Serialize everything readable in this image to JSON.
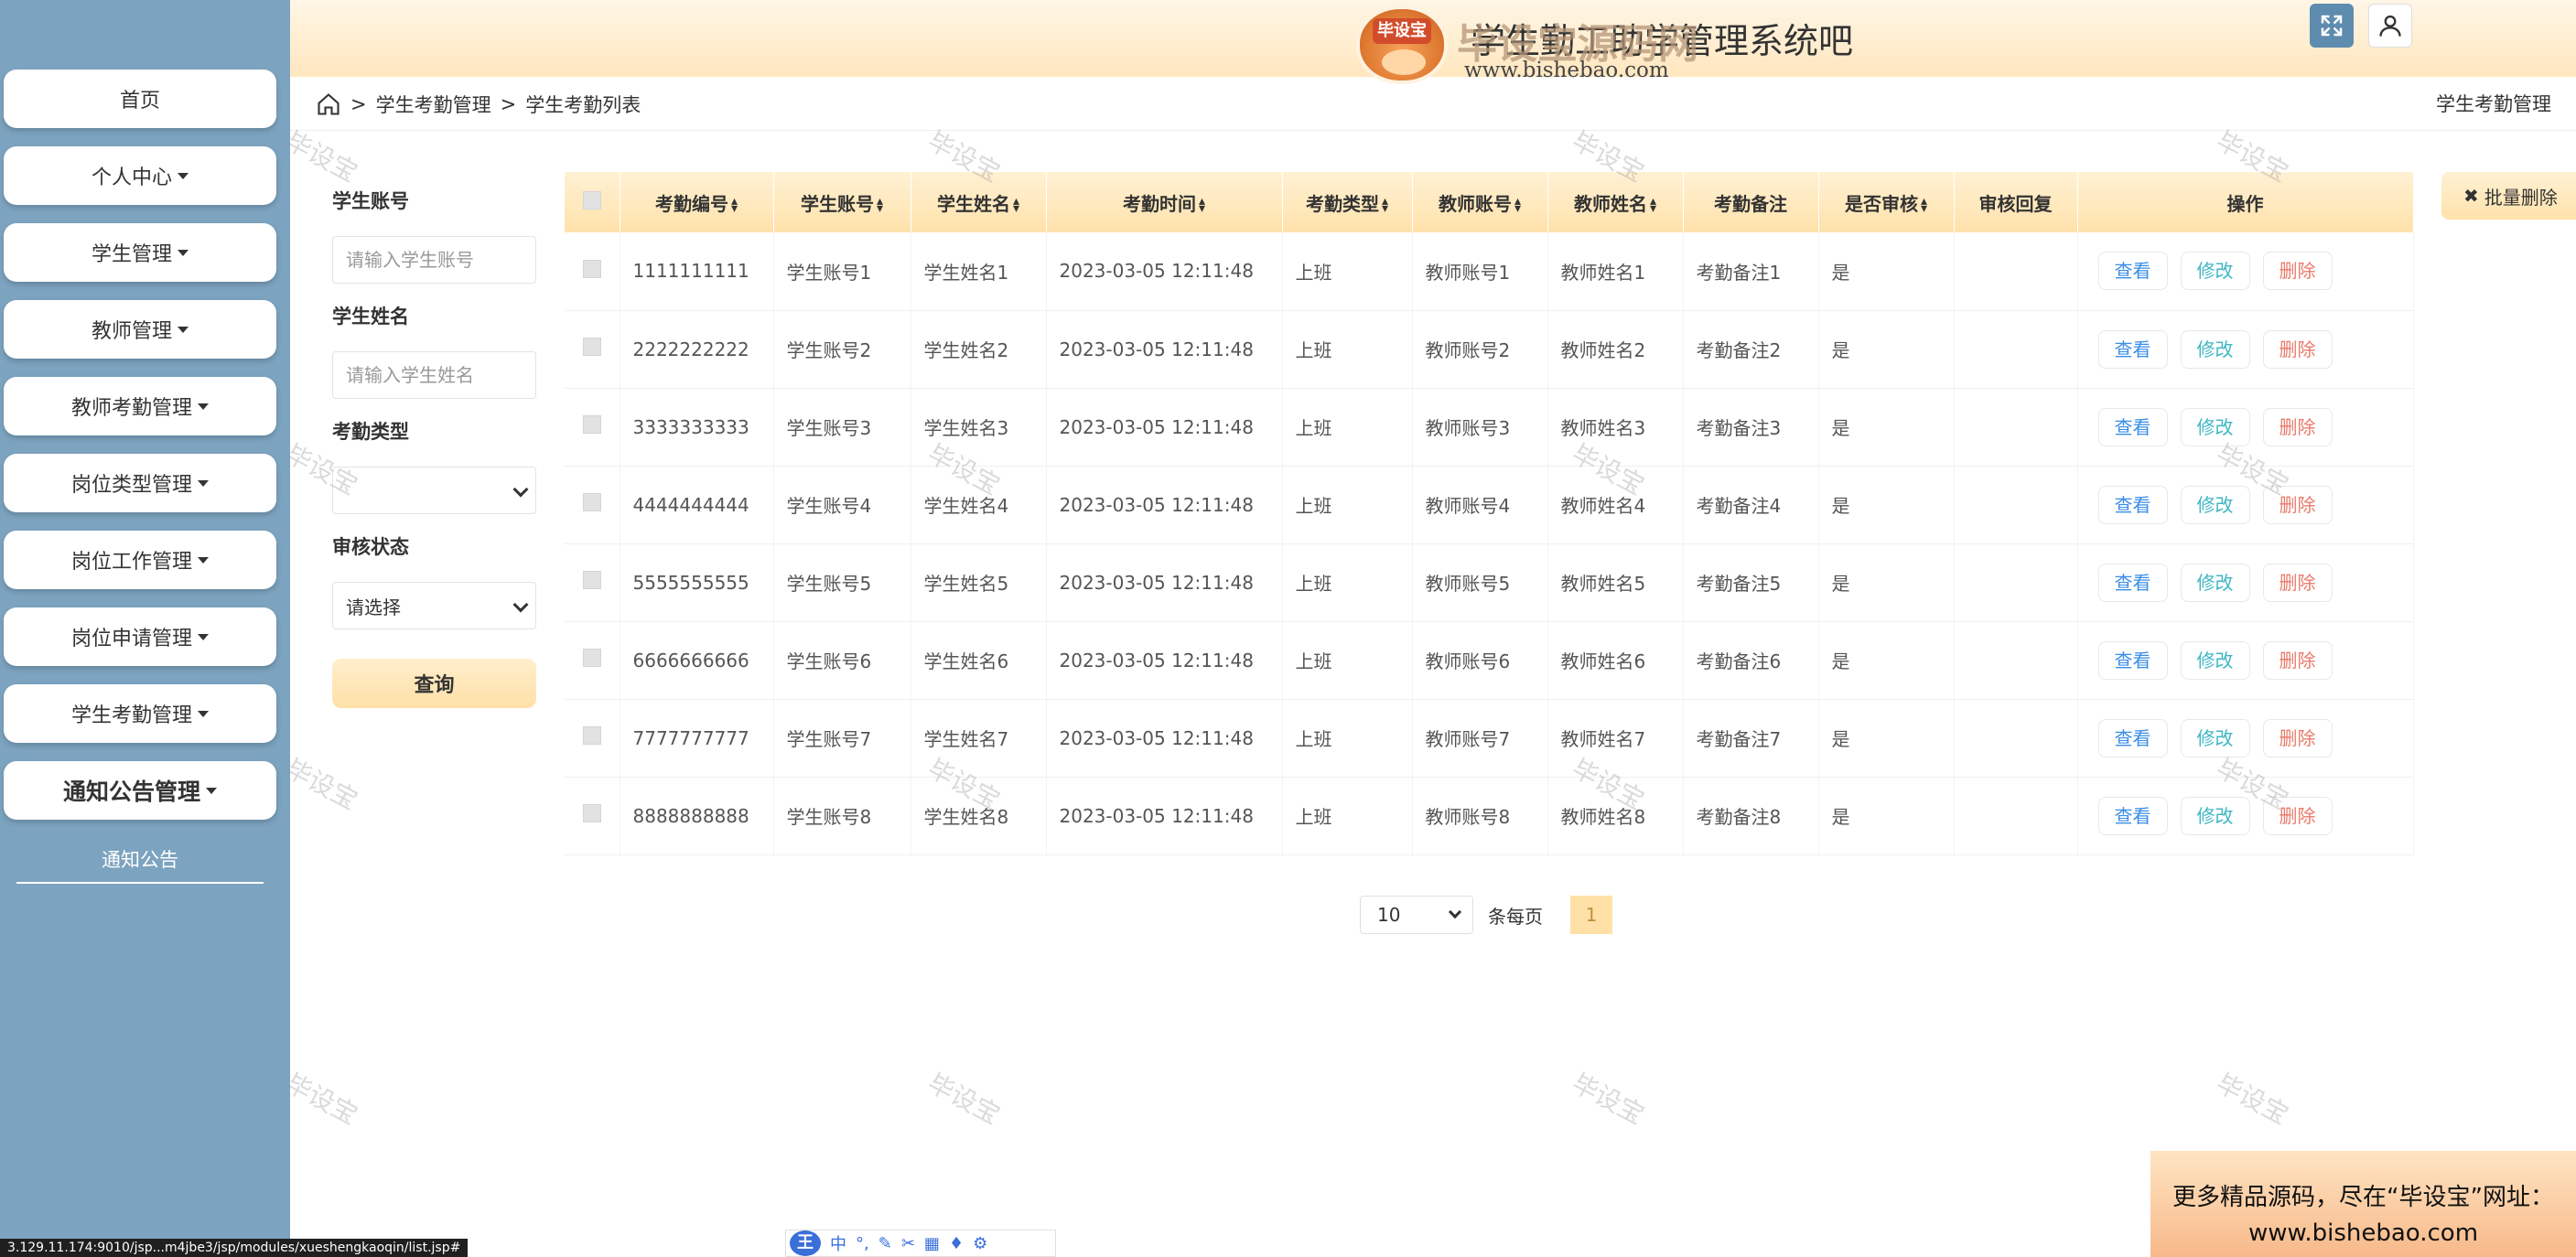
{
  "header": {
    "title": "学生勤工助学管理系统吧",
    "logo_badge": "毕设宝",
    "logo_main": "毕设宝源码网",
    "logo_url": "www.bishebao.com"
  },
  "sidebar": {
    "items": [
      {
        "label": "首页",
        "caret": false
      },
      {
        "label": "个人中心",
        "caret": true
      },
      {
        "label": "学生管理",
        "caret": true
      },
      {
        "label": "教师管理",
        "caret": true
      },
      {
        "label": "教师考勤管理",
        "caret": true
      },
      {
        "label": "岗位类型管理",
        "caret": true
      },
      {
        "label": "岗位工作管理",
        "caret": true
      },
      {
        "label": "岗位申请管理",
        "caret": true
      },
      {
        "label": "学生考勤管理",
        "caret": true
      },
      {
        "label": "通知公告管理",
        "caret": true
      }
    ],
    "submenu": "通知公告"
  },
  "breadcrumb": {
    "items": [
      "学生考勤管理",
      "学生考勤列表"
    ],
    "right": "学生考勤管理"
  },
  "search": {
    "student_account_label": "学生账号",
    "student_account_placeholder": "请输入学生账号",
    "student_name_label": "学生姓名",
    "student_name_placeholder": "请输入学生姓名",
    "type_label": "考勤类型",
    "type_value": "",
    "status_label": "审核状态",
    "status_value": "请选择",
    "search_button": "查询"
  },
  "batch_delete": "批量删除",
  "table": {
    "headers": [
      {
        "label": "考勤编号",
        "sortable": true
      },
      {
        "label": "学生账号",
        "sortable": true
      },
      {
        "label": "学生姓名",
        "sortable": true
      },
      {
        "label": "考勤时间",
        "sortable": true
      },
      {
        "label": "考勤类型",
        "sortable": true
      },
      {
        "label": "教师账号",
        "sortable": true
      },
      {
        "label": "教师姓名",
        "sortable": true
      },
      {
        "label": "考勤备注",
        "sortable": false
      },
      {
        "label": "是否审核",
        "sortable": true
      },
      {
        "label": "审核回复",
        "sortable": false
      },
      {
        "label": "操作",
        "sortable": false
      }
    ],
    "actions": {
      "view": "查看",
      "edit": "修改",
      "delete": "删除"
    },
    "rows": [
      [
        "1111111111",
        "学生账号1",
        "学生姓名1",
        "2023-03-05 12:11:48",
        "上班",
        "教师账号1",
        "教师姓名1",
        "考勤备注1",
        "是",
        ""
      ],
      [
        "2222222222",
        "学生账号2",
        "学生姓名2",
        "2023-03-05 12:11:48",
        "上班",
        "教师账号2",
        "教师姓名2",
        "考勤备注2",
        "是",
        ""
      ],
      [
        "3333333333",
        "学生账号3",
        "学生姓名3",
        "2023-03-05 12:11:48",
        "上班",
        "教师账号3",
        "教师姓名3",
        "考勤备注3",
        "是",
        ""
      ],
      [
        "4444444444",
        "学生账号4",
        "学生姓名4",
        "2023-03-05 12:11:48",
        "上班",
        "教师账号4",
        "教师姓名4",
        "考勤备注4",
        "是",
        ""
      ],
      [
        "5555555555",
        "学生账号5",
        "学生姓名5",
        "2023-03-05 12:11:48",
        "上班",
        "教师账号5",
        "教师姓名5",
        "考勤备注5",
        "是",
        ""
      ],
      [
        "6666666666",
        "学生账号6",
        "学生姓名6",
        "2023-03-05 12:11:48",
        "上班",
        "教师账号6",
        "教师姓名6",
        "考勤备注6",
        "是",
        ""
      ],
      [
        "7777777777",
        "学生账号7",
        "学生姓名7",
        "2023-03-05 12:11:48",
        "上班",
        "教师账号7",
        "教师姓名7",
        "考勤备注7",
        "是",
        ""
      ],
      [
        "8888888888",
        "学生账号8",
        "学生姓名8",
        "2023-03-05 12:11:48",
        "上班",
        "教师账号8",
        "教师姓名8",
        "考勤备注8",
        "是",
        ""
      ]
    ]
  },
  "pagination": {
    "page_size": "10",
    "per_page_label": "条每页",
    "current_page": "1"
  },
  "watermark": "毕设宝",
  "ad": {
    "line1": "更多精品源码，尽在“毕设宝”网址：",
    "line2": "www.bishebao.com"
  },
  "status_url": "3.129.11.174:9010/jsp...m4jbe3/jsp/modules/xueshengkaoqin/list.jsp#",
  "ime": {
    "badge": "王",
    "mode": "中"
  },
  "colors": {
    "sidebar": "#7ca3bf",
    "header_gradient_top": "#fff6e6",
    "header_gradient_bottom": "#ffe7bf",
    "view_button": "#3a8ee6",
    "edit_button": "#3fb7c4",
    "delete_button": "#e87a6a",
    "expand_button": "#5e8cae"
  }
}
